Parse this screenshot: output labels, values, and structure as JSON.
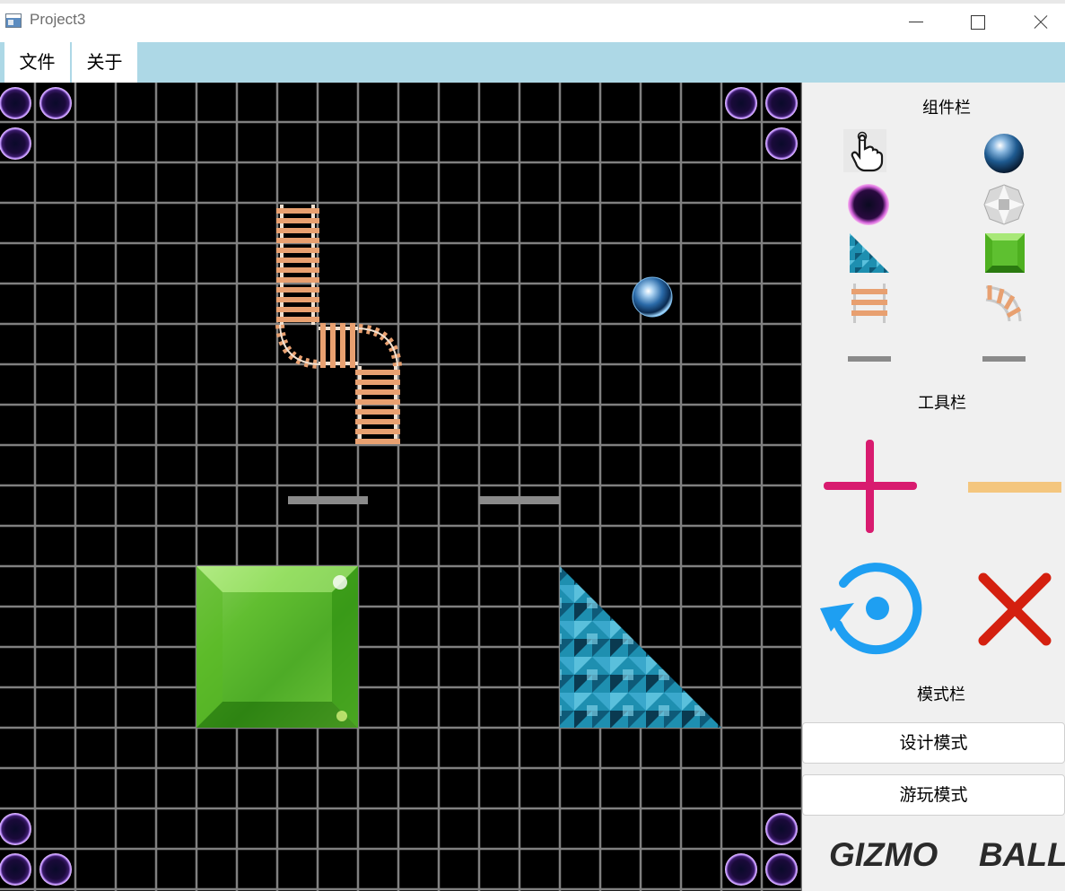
{
  "window": {
    "title": "Project3"
  },
  "menu": {
    "file": "文件",
    "about": "关于"
  },
  "panel": {
    "components_title": "组件栏",
    "components": [
      {
        "name": "hand-icon"
      },
      {
        "name": "ball-icon"
      },
      {
        "name": "absorber-icon"
      },
      {
        "name": "diamond-icon"
      },
      {
        "name": "triangle-icon"
      },
      {
        "name": "square-icon"
      },
      {
        "name": "straight-track-icon"
      },
      {
        "name": "curved-track-icon"
      },
      {
        "name": "left-flipper-icon"
      },
      {
        "name": "right-flipper-icon"
      }
    ],
    "tools_title": "工具栏",
    "tools": [
      {
        "name": "zoom-in-icon",
        "color": "#d81b6f"
      },
      {
        "name": "zoom-out-icon",
        "color": "#f4c67e"
      },
      {
        "name": "rotate-icon",
        "color": "#1e9ff2"
      },
      {
        "name": "delete-icon",
        "color": "#d4200f"
      }
    ],
    "modes_title": "模式栏",
    "design_mode": "设计模式",
    "play_mode": "游玩模式",
    "brand_left": "GIZMO",
    "brand_right": "BALL"
  },
  "board": {
    "grid_color": "#808080",
    "track_color": "#e8a070",
    "triangle_color": "#2a9fc0",
    "square_color": "#4ea820"
  }
}
